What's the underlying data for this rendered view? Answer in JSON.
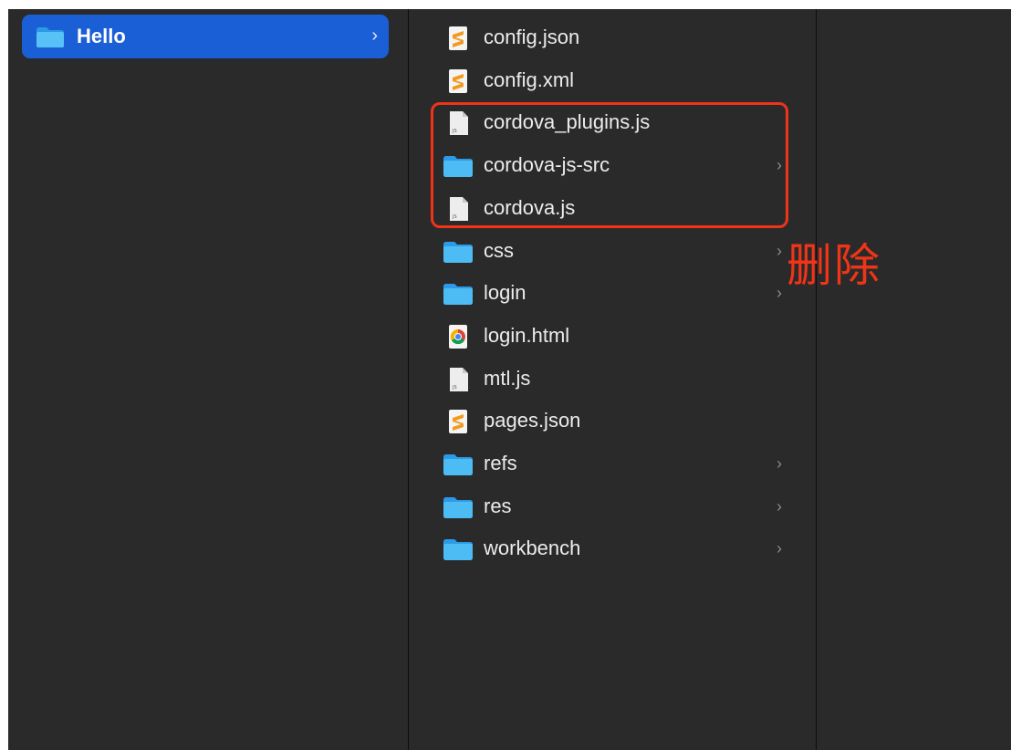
{
  "columns": {
    "left": {
      "selected_item": {
        "label": "Hello",
        "icon": "folder-icon",
        "chevron": "›"
      }
    },
    "middle": {
      "items": [
        {
          "name": "config.json",
          "icon": "sublime-file-icon",
          "has_children": false
        },
        {
          "name": "config.xml",
          "icon": "sublime-file-icon",
          "has_children": false
        },
        {
          "name": "cordova_plugins.js",
          "icon": "js-file-icon",
          "has_children": false
        },
        {
          "name": "cordova-js-src",
          "icon": "folder-icon",
          "has_children": true
        },
        {
          "name": "cordova.js",
          "icon": "js-file-icon",
          "has_children": false
        },
        {
          "name": "css",
          "icon": "folder-icon",
          "has_children": true
        },
        {
          "name": "login",
          "icon": "folder-icon",
          "has_children": true
        },
        {
          "name": "login.html",
          "icon": "chrome-file-icon",
          "has_children": false
        },
        {
          "name": "mtl.js",
          "icon": "js-file-icon",
          "has_children": false
        },
        {
          "name": "pages.json",
          "icon": "sublime-file-icon",
          "has_children": false
        },
        {
          "name": "refs",
          "icon": "folder-icon",
          "has_children": true
        },
        {
          "name": "res",
          "icon": "folder-icon",
          "has_children": true
        },
        {
          "name": "workbench",
          "icon": "folder-icon",
          "has_children": true
        }
      ],
      "chevron": "›"
    }
  },
  "annotation": {
    "text": "删除",
    "highlighted_items": [
      "cordova_plugins.js",
      "cordova-js-src",
      "cordova.js"
    ],
    "color": "#ef3418"
  },
  "colors": {
    "background": "#2a2a2a",
    "selection": "#1a5fd6",
    "folder": "#3cb0f0",
    "text": "#ececec"
  }
}
